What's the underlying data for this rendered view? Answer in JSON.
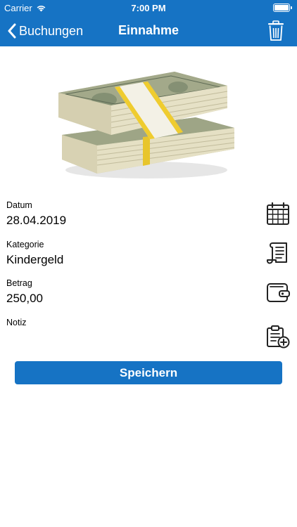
{
  "status_bar": {
    "carrier": "Carrier",
    "time": "7:00 PM"
  },
  "nav": {
    "back_label": "Buchungen",
    "title": "Einnahme",
    "trash_icon": "trash-icon"
  },
  "hero_image": "money-stack-image",
  "fields": {
    "date": {
      "label": "Datum",
      "value": "28.04.2019",
      "icon": "calendar-icon"
    },
    "category": {
      "label": "Kategorie",
      "value": "Kindergeld",
      "icon": "receipt-icon"
    },
    "amount": {
      "label": "Betrag",
      "value": "250,00",
      "icon": "wallet-icon"
    },
    "note": {
      "label": "Notiz",
      "value": "",
      "icon": "clipboard-add-icon"
    }
  },
  "save_label": "Speichern",
  "colors": {
    "primary": "#1673c4",
    "background": "#ffffff"
  }
}
